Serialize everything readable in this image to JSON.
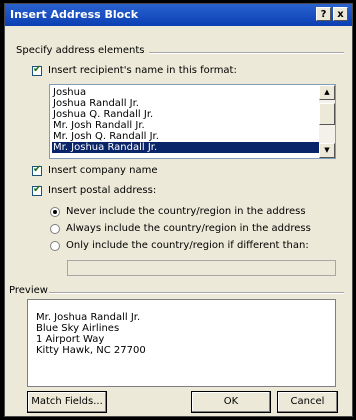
{
  "dialog": {
    "title": "Insert Address Block",
    "help_label": "?",
    "close_label": "x"
  },
  "address_elements": {
    "group_label": "Specify address elements",
    "recipient_name_label": "Insert recipient's name in this format:",
    "name_formats": [
      "Joshua",
      "Joshua Randall Jr.",
      "Joshua Q. Randall Jr.",
      "Mr. Josh Randall Jr.",
      "Mr. Josh Q. Randall Jr.",
      "Mr. Joshua Randall Jr."
    ],
    "selected_format": "Mr. Joshua Randall Jr.",
    "company_name_label": "Insert company name",
    "postal_address_label": "Insert postal address:",
    "country_options": [
      "Never include the country/region in the address",
      "Always include the country/region in the address",
      "Only include the country/region if different than:"
    ],
    "selected_country_option": "Never include the country/region in the address",
    "country_value": ""
  },
  "preview": {
    "group_label": "Preview",
    "lines": [
      "Mr. Joshua Randall Jr.",
      "Blue Sky Airlines",
      "1 Airport Way",
      "Kitty Hawk, NC 27700"
    ]
  },
  "buttons": {
    "match_fields": "Match Fields...",
    "ok": "OK",
    "cancel": "Cancel"
  }
}
